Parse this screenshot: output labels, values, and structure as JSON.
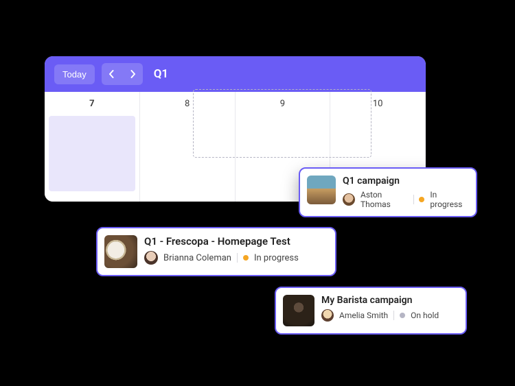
{
  "colors": {
    "primary": "#6A5CF5",
    "status_in_progress": "#F5A623",
    "status_on_hold": "#B5B5C4"
  },
  "calendar": {
    "today_label": "Today",
    "title": "Q1",
    "days": [
      "7",
      "8",
      "9",
      "10"
    ],
    "selected_day": "7"
  },
  "cards": {
    "q1": {
      "title": "Q1 campaign",
      "owner": "Aston Thomas",
      "status": "In progress",
      "status_kind": "in_progress",
      "thumb": "landscape"
    },
    "frescopa": {
      "title": "Q1 - Frescopa - Homepage Test",
      "owner": "Brianna Coleman",
      "status": "In progress",
      "status_kind": "in_progress",
      "thumb": "espresso"
    },
    "barista": {
      "title": "My Barista campaign",
      "owner": "Amelia Smith",
      "status": "On hold",
      "status_kind": "on_hold",
      "thumb": "barista"
    }
  }
}
